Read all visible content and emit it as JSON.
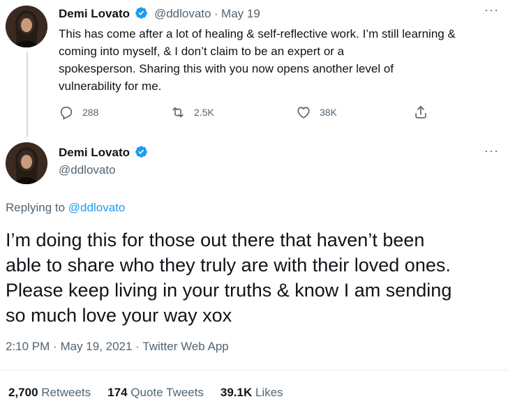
{
  "reply_tweet": {
    "author_name": "Demi Lovato",
    "handle": "@ddlovato",
    "date": "May 19",
    "separator": "·",
    "text_lines": [
      "This has come after a lot of healing & self-reflective work. I’m still learning &",
      "coming into myself, & I don’t claim to be an expert or a",
      "spokesperson. Sharing this with you now opens another level of",
      "vulnerability for me."
    ],
    "actions": {
      "replies": "288",
      "retweets": "2.5K",
      "likes": "38K"
    },
    "icons": [
      "reply-icon",
      "retweet-icon",
      "like-icon",
      "share-icon"
    ]
  },
  "main_tweet": {
    "author_name": "Demi Lovato",
    "handle": "@ddlovato",
    "replying_label": "Replying to",
    "replying_to": "@ddlovato",
    "text_lines": [
      "I’m doing this for those out there that haven’t been",
      "able to share who they truly are with their loved ones.",
      "Please keep living in your truths & know I am sending",
      "so much love your way xox"
    ],
    "time": "2:10 PM",
    "date": "May 19, 2021",
    "source": "Twitter Web App",
    "separator": "·",
    "stats": {
      "retweets_count": "2,700",
      "retweets_label": "Retweets",
      "quotes_count": "174",
      "quotes_label": "Quote Tweets",
      "likes_count": "39.1K",
      "likes_label": "Likes"
    }
  },
  "colors": {
    "verified": "#1d9bf0",
    "secondary_text": "#536471",
    "link": "#1d9bf0"
  }
}
